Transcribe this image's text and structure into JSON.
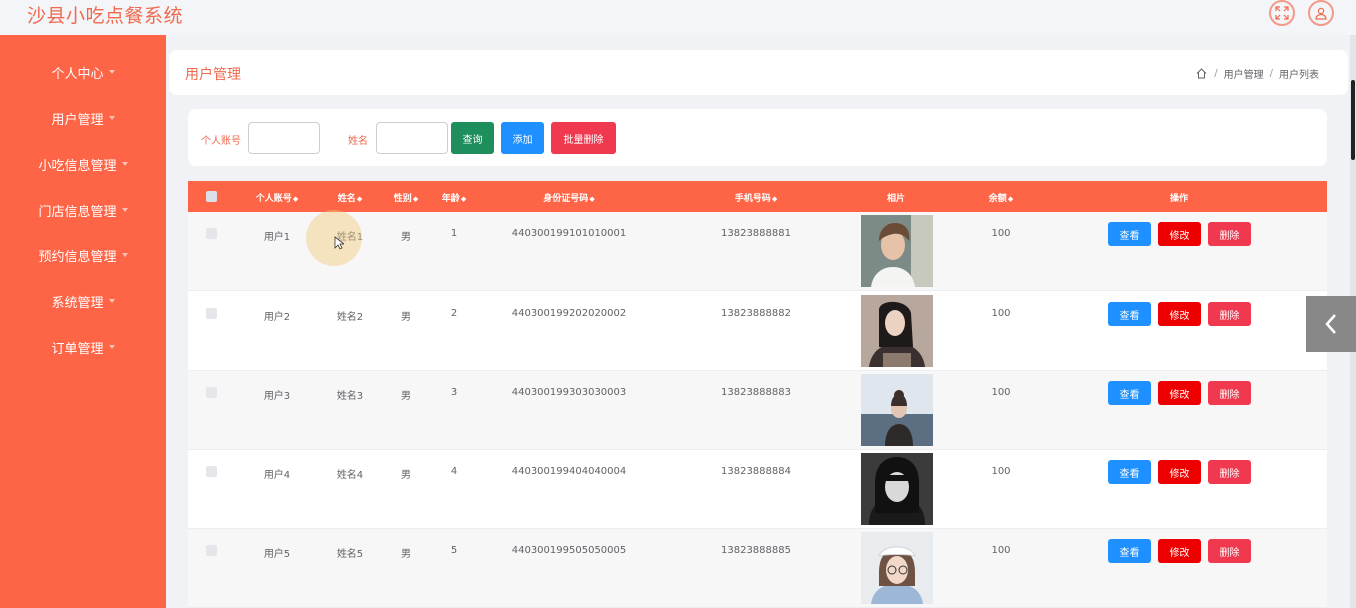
{
  "app": {
    "title": "沙县小吃点餐系统"
  },
  "header_icons": [
    "fullscreen-icon",
    "user-icon"
  ],
  "colors": {
    "accent": "#fe6446",
    "title": "#ef6a4f",
    "query": "#1e8f5c",
    "add": "#1e90ff",
    "batch_delete": "#f0394f",
    "edit": "#ee0000",
    "delete": "#f0394f"
  },
  "sidebar": {
    "items": [
      {
        "label": "个人中心"
      },
      {
        "label": "用户管理"
      },
      {
        "label": "小吃信息管理"
      },
      {
        "label": "门店信息管理"
      },
      {
        "label": "预约信息管理"
      },
      {
        "label": "系统管理"
      },
      {
        "label": "订单管理"
      }
    ]
  },
  "breadcrumb": {
    "title": "用户管理",
    "path": [
      "用户管理",
      "用户列表"
    ],
    "separator": "/"
  },
  "search": {
    "account_label": "个人账号",
    "account_value": "",
    "name_label": "姓名",
    "name_value": "",
    "query_button": "查询",
    "add_button": "添加",
    "batch_delete_button": "批量删除"
  },
  "table": {
    "columns": [
      "个人账号",
      "姓名",
      "性别",
      "年龄",
      "身份证号码",
      "手机号码",
      "相片",
      "余额",
      "操作"
    ],
    "actions": {
      "view": "查看",
      "edit": "修改",
      "delete": "删除"
    },
    "rows": [
      {
        "account": "用户1",
        "name": "姓名1",
        "gender": "男",
        "age": "1",
        "id_card": "440300199101010001",
        "phone": "13823888881",
        "photo": "portrait-young-man",
        "balance": "100"
      },
      {
        "account": "用户2",
        "name": "姓名2",
        "gender": "男",
        "age": "2",
        "id_card": "440300199202020002",
        "phone": "13823888882",
        "photo": "portrait-woman-dark-hair",
        "balance": "100"
      },
      {
        "account": "用户3",
        "name": "姓名3",
        "gender": "男",
        "age": "3",
        "id_card": "440300199303030003",
        "phone": "13823888883",
        "photo": "portrait-woman-seaside",
        "balance": "100"
      },
      {
        "account": "用户4",
        "name": "姓名4",
        "gender": "男",
        "age": "4",
        "id_card": "440300199404040004",
        "phone": "13823888884",
        "photo": "portrait-woman-black-white",
        "balance": "100"
      },
      {
        "account": "用户5",
        "name": "姓名5",
        "gender": "男",
        "age": "5",
        "id_card": "440300199505050005",
        "phone": "13823888885",
        "photo": "portrait-woman-white-cap",
        "balance": "100"
      }
    ]
  }
}
